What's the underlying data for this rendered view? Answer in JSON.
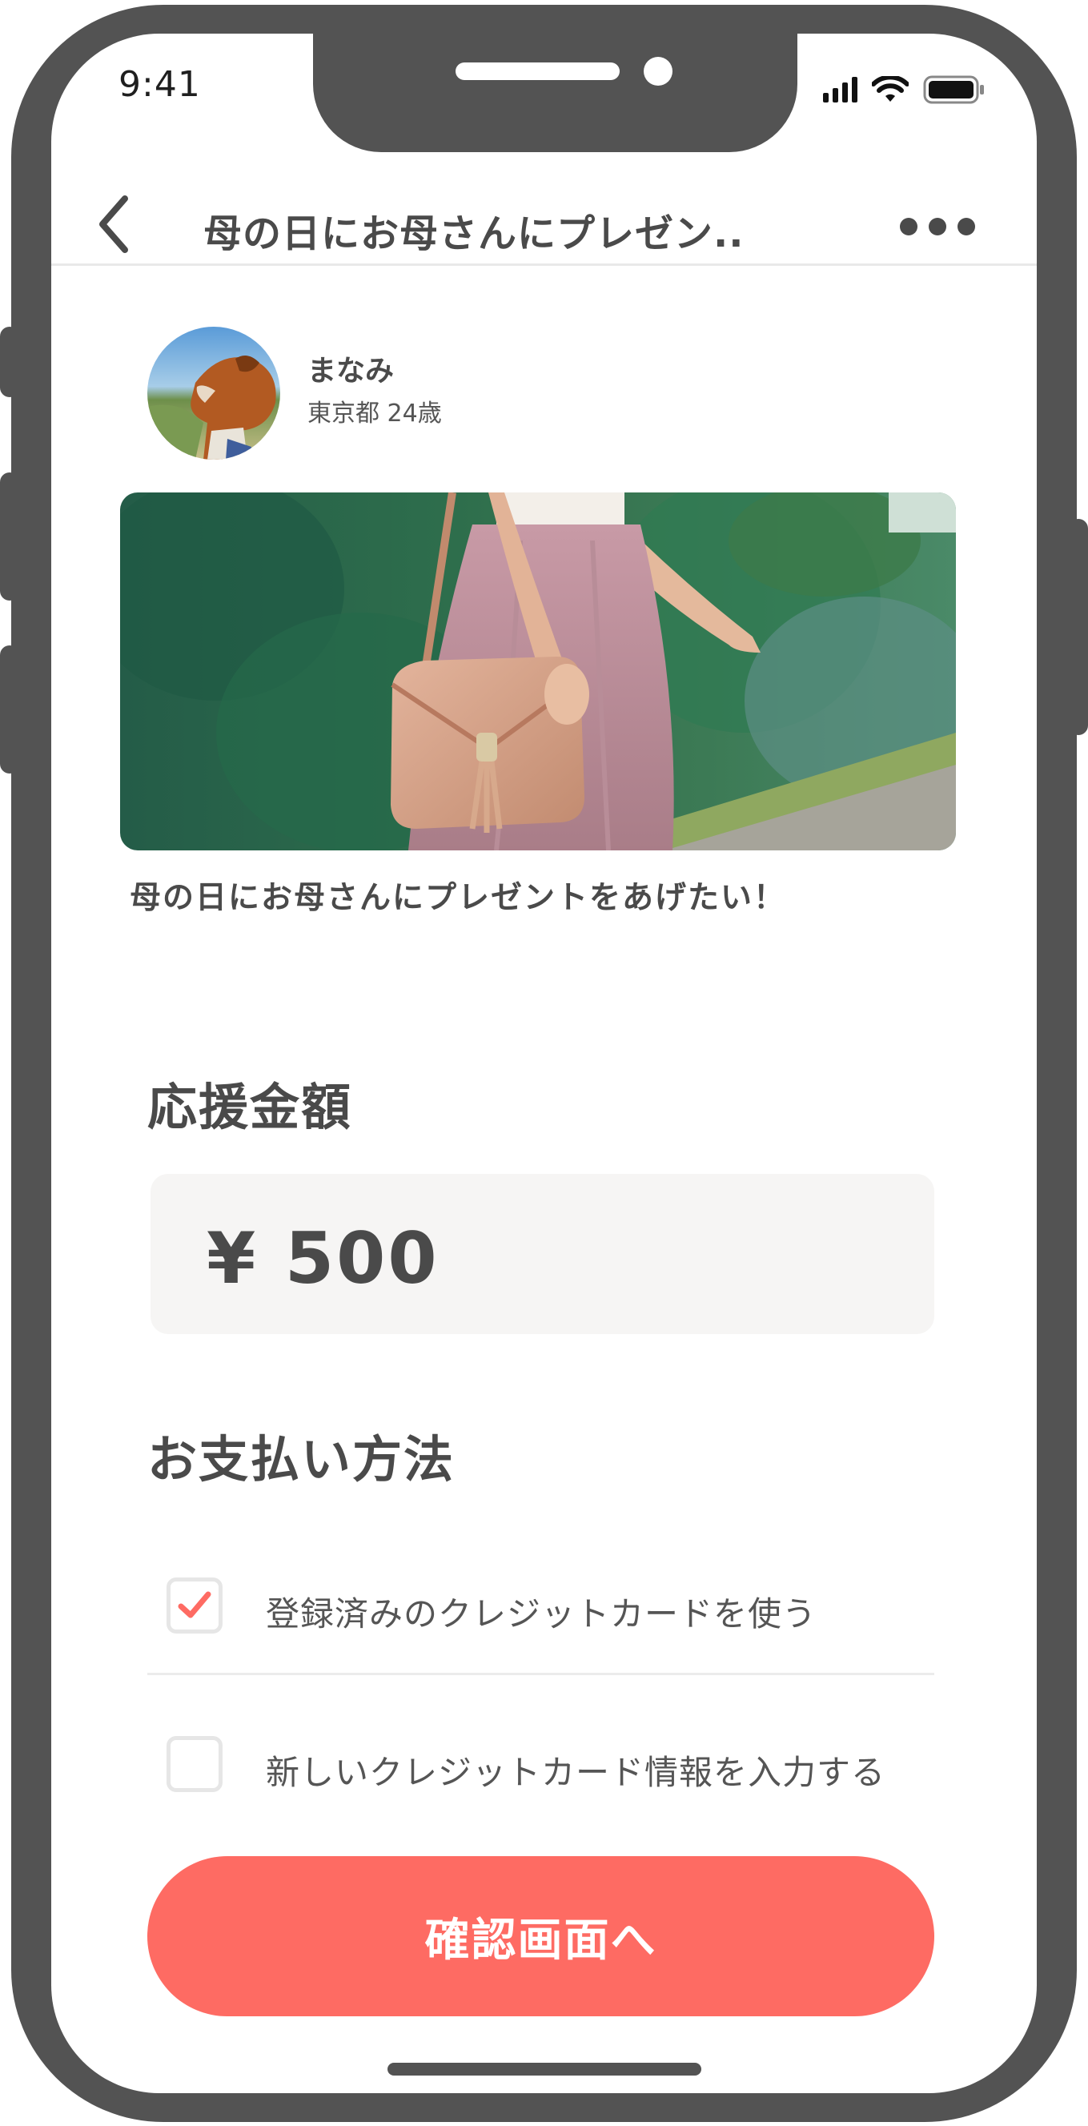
{
  "status_bar": {
    "time": "9:41"
  },
  "nav": {
    "title": "母の日にお母さんにプレゼン.."
  },
  "profile": {
    "name": "まなみ",
    "meta": "東京都 24歳"
  },
  "post": {
    "title": "母の日にお母さんにプレゼントをあげたい！"
  },
  "amount": {
    "heading": "応援金額",
    "value": "¥ 500"
  },
  "payment": {
    "heading": "お支払い方法",
    "options": [
      {
        "label": "登録済みのクレジットカードを使う",
        "checked": true
      },
      {
        "label": "新しいクレジットカード情報を入力する",
        "checked": false
      }
    ]
  },
  "cta": {
    "label": "確認画面へ"
  },
  "colors": {
    "accent": "#fe6b63",
    "frame": "#535353",
    "text": "#4a4a4a"
  }
}
